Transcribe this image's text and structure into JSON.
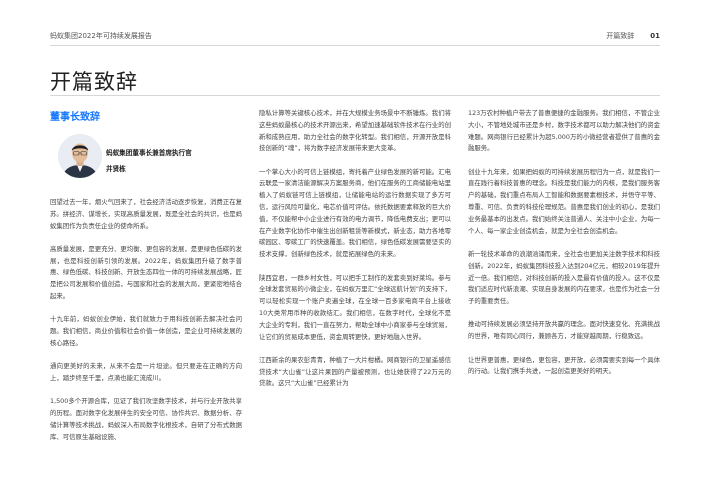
{
  "header": {
    "report_title": "蚂蚁集团2022年可持续发展报告",
    "section_label": "开篇致辞",
    "page_number": "01"
  },
  "page": {
    "title": "开篇致辞"
  },
  "chair": {
    "heading": "董事长致辞",
    "title": "蚂蚁集团董事长兼首席执行官",
    "name": "井贤栋"
  },
  "columns": {
    "col1": [
      "回望过去一年，烟火气回来了，社会经济活动逐步恢复，消费正在复苏。拼经济、谋增长，实现高质量发展，既是全社会的共识，也是蚂蚁集团作为负责任企业的使命所系。",
      "高质量发展，是更充分、更均衡、更包容的发展，是更绿色低碳的发展，也是科技创新引领的发展。2022年，蚂蚁集团升级了数字普惠、绿色低碳、科技创新、开放生态四位一体的可持续发展战略，匠是把公司发展和价值创造，与国家和社会的发展大局，更紧密地结合起来。",
      "十九年前，蚂蚁创业伊始，我们就致力于用科技创新去解决社会问题。我们相信，商业价值和社会价值一体创造，是企业可持续发展的核心路径。",
      "通向更美好的未来，从来不会是一片坦途。但只要走在正确的方向上，踏步终至千里，点滴也能汇流成川。",
      "1,500多个开源合库，见证了我们攻坚数字技术，并与行业开放共享的历程。面对数字化发展伴生的安全可信、协作共识、数据分析、存储计算等技术挑战，蚂蚁深入布局数字化根技术，自研了分布式数据库、可信原生基础设施、"
    ],
    "col2": [
      "隐私计算等关键核心技术，并在大规模业务场景中不断锤炼。我们将这些蚂蚁最核心的技术开源出来，希望加速基础软件技术在行业的创新和成熟应用，助力全社会的数字化转型。我们相信，开源开放是科技创新的“魂”，将为数字经济发展带来更大变革。",
      "一个掌心大小的可信上链模组，寄托着产业绿色发展的新可能。汇电云联是一家清洁能源解决方案服务商，他们在服务的工商储能电站里植入了蚂蚁链可信上链模组，让储能电站的运行数据实现了多方可信，运行风险可量化，电芯价值可评估。依托数据要素释放的巨大价值，不仅能帮中小企业进行有效的电力调节，降低电费支出；更可以在产业数字化协作中催生出创新租赁等新模式，新业态，助力各地零碳园区、零碳工厂的快速覆盖。我们相信，绿色低碳发展需要坚实的技术支撑，创新绿色技术，就是拓展绿色的未来。",
      "陕西宜君，一群乡村女性，可以把手工制作的发套卖到好莱坞。参与全球发套贸易的小微企业，在蚂蚁万里汇“全球远航计划”的支持下，可以轻松实现一个账户卖遍全球，在全球一百多家电商平台上接收10大类常用币种的收款结汇。我们相信，在数字时代，全球化不是大企业的专利，我们一直在努力，帮助全球中小商家参与全球贸易，让它们的贸易成本更低，资金周转更快，更好地融入世界。",
      "江西新余的果农彭青青，种植了一大片柑橘。网商银行的卫星遥感信贷技术“大山雀”让这片果园的产量被预测，也让她获得了22万元的贷款。这只“大山雀”已经累计为"
    ],
    "col3": [
      "123万农村种植户带去了普惠便捷的金融服务。我们相信，不管企业大小，不管地处城市还是乡村，数字技术都可以助力解决他们的资金难题。网商银行已经累计为超5,000万的小微经营者提供了普惠的金融服务。",
      "创业十九年来，如果把蚂蚁的可持续发展历程归为一点，就是我们一直在践行着科技普惠的理念。科技是我们能力的内核，是我们服务客户的基础，我们重点布局人工智能和数据要素根技术，并悟守平等、尊重、可信、负责的科技伦理规范。普惠是我们创业的初心，是我们业务最基本的出发点。我们始终关注普通人、关注中小企业，为每一个人、每一家企业创造机会，就是为全社会创造机会。",
      "新一轮技术革命的浪潮汹涌而来，全社会也更加关注数字技术和科技创新。2022年，蚂蚁集团科技投入达到204亿元，相较2019年提升近一倍。我们相信，对科技创新的投入是最有价值的投入。这不仅是我们适应时代新浪潮、实现自身发展的内在要求，也是作为社会一分子的重要责任。",
      "推动可持续发展必须坚持开放共赢的理念。面对快速变化、充满挑战的世界，唯有同心同行，兼顾各方，才能穿越周期，行稳致远。",
      "让世界更普惠，更绿色，更包容，更开放，必须需要实到每一个具体的行动。让我们携手共进，一起创造更美好的明天。"
    ]
  },
  "colors": {
    "accent_blue": "#1677ff",
    "text": "#444444",
    "rule": "#d6d6d6"
  }
}
